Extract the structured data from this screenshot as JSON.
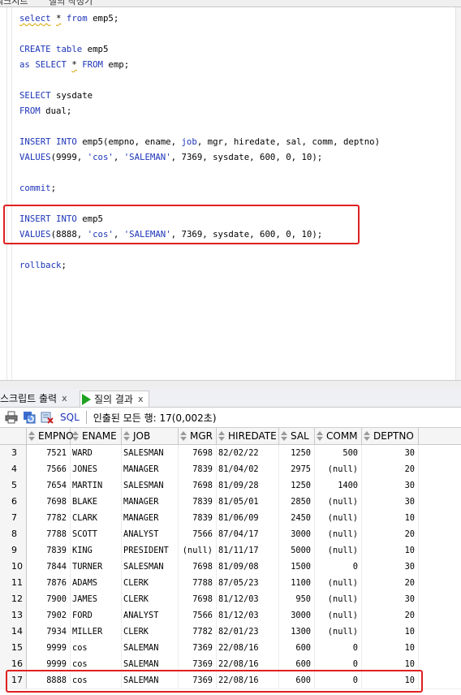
{
  "top_tabs": [
    "워크시트",
    "질의 작성기"
  ],
  "editor": {
    "lines": [
      {
        "parts": [
          {
            "t": "select",
            "c": "kw squig"
          },
          {
            "t": " ",
            "c": ""
          },
          {
            "t": "*",
            "c": "squig"
          },
          {
            "t": " ",
            "c": ""
          },
          {
            "t": "from",
            "c": "kw"
          },
          {
            "t": " emp5;",
            "c": ""
          }
        ]
      },
      {
        "parts": []
      },
      {
        "parts": [
          {
            "t": "CREATE",
            "c": "kw"
          },
          {
            "t": " ",
            "c": ""
          },
          {
            "t": "table",
            "c": "kw"
          },
          {
            "t": " emp5",
            "c": ""
          }
        ]
      },
      {
        "parts": [
          {
            "t": "as",
            "c": "kw"
          },
          {
            "t": " ",
            "c": ""
          },
          {
            "t": "SELECT",
            "c": "kw"
          },
          {
            "t": " ",
            "c": ""
          },
          {
            "t": "*",
            "c": "squig"
          },
          {
            "t": " ",
            "c": ""
          },
          {
            "t": "FROM",
            "c": "kw"
          },
          {
            "t": " emp;",
            "c": ""
          }
        ]
      },
      {
        "parts": []
      },
      {
        "parts": [
          {
            "t": "SELECT",
            "c": "kw"
          },
          {
            "t": " sysdate",
            "c": ""
          }
        ]
      },
      {
        "parts": [
          {
            "t": "FROM",
            "c": "kw"
          },
          {
            "t": " dual;",
            "c": ""
          }
        ]
      },
      {
        "parts": []
      },
      {
        "parts": [
          {
            "t": "INSERT",
            "c": "kw"
          },
          {
            "t": " ",
            "c": ""
          },
          {
            "t": "INTO",
            "c": "kw"
          },
          {
            "t": " emp5(empno, ename, ",
            "c": ""
          },
          {
            "t": "job",
            "c": "kw"
          },
          {
            "t": ", mgr, hiredate, sal, comm, deptno)",
            "c": ""
          }
        ]
      },
      {
        "parts": [
          {
            "t": "VALUES",
            "c": "kw"
          },
          {
            "t": "(9999, ",
            "c": ""
          },
          {
            "t": "'cos'",
            "c": "str"
          },
          {
            "t": ", ",
            "c": ""
          },
          {
            "t": "'SALEMAN'",
            "c": "str"
          },
          {
            "t": ", 7369, sysdate, 600, 0, 10);",
            "c": ""
          }
        ]
      },
      {
        "parts": []
      },
      {
        "parts": [
          {
            "t": "commit",
            "c": "kw"
          },
          {
            "t": ";",
            "c": ""
          }
        ]
      },
      {
        "parts": []
      },
      {
        "parts": [
          {
            "t": "INSERT",
            "c": "kw"
          },
          {
            "t": " ",
            "c": ""
          },
          {
            "t": "INTO",
            "c": "kw"
          },
          {
            "t": " emp5",
            "c": ""
          }
        ]
      },
      {
        "parts": [
          {
            "t": "VALUES",
            "c": "kw"
          },
          {
            "t": "(8888, ",
            "c": ""
          },
          {
            "t": "'cos'",
            "c": "str"
          },
          {
            "t": ", ",
            "c": ""
          },
          {
            "t": "'SALEMAN'",
            "c": "str"
          },
          {
            "t": ", 7369, sysdate, 600, 0, 10);",
            "c": ""
          }
        ]
      },
      {
        "parts": []
      },
      {
        "parts": [
          {
            "t": "rollback",
            "c": "kw"
          },
          {
            "t": ";",
            "c": ""
          }
        ]
      }
    ]
  },
  "bottom_tabs": {
    "script_output": "스크립트 출력",
    "query_result": "질의 결과",
    "close": "x"
  },
  "toolbar": {
    "sql_label": "SQL",
    "status": "인출된 모든 행: 17(0,002초)",
    "icons": [
      "print-icon",
      "refresh-icon",
      "export-icon"
    ]
  },
  "grid": {
    "columns": [
      "EMPNO",
      "ENAME",
      "JOB",
      "MGR",
      "HIREDATE",
      "SAL",
      "COMM",
      "DEPTNO"
    ],
    "rows": [
      {
        "n": "3",
        "empno": "7521",
        "ename": "WARD",
        "job": "SALESMAN",
        "mgr": "7698",
        "hiredate": "82/02/22",
        "sal": "1250",
        "comm": "500",
        "deptno": "30"
      },
      {
        "n": "4",
        "empno": "7566",
        "ename": "JONES",
        "job": "MANAGER",
        "mgr": "7839",
        "hiredate": "81/04/02",
        "sal": "2975",
        "comm": "(null)",
        "deptno": "20"
      },
      {
        "n": "5",
        "empno": "7654",
        "ename": "MARTIN",
        "job": "SALESMAN",
        "mgr": "7698",
        "hiredate": "81/09/28",
        "sal": "1250",
        "comm": "1400",
        "deptno": "30"
      },
      {
        "n": "6",
        "empno": "7698",
        "ename": "BLAKE",
        "job": "MANAGER",
        "mgr": "7839",
        "hiredate": "81/05/01",
        "sal": "2850",
        "comm": "(null)",
        "deptno": "30"
      },
      {
        "n": "7",
        "empno": "7782",
        "ename": "CLARK",
        "job": "MANAGER",
        "mgr": "7839",
        "hiredate": "81/06/09",
        "sal": "2450",
        "comm": "(null)",
        "deptno": "10"
      },
      {
        "n": "8",
        "empno": "7788",
        "ename": "SCOTT",
        "job": "ANALYST",
        "mgr": "7566",
        "hiredate": "87/04/17",
        "sal": "3000",
        "comm": "(null)",
        "deptno": "20"
      },
      {
        "n": "9",
        "empno": "7839",
        "ename": "KING",
        "job": "PRESIDENT",
        "mgr": "(null)",
        "hiredate": "81/11/17",
        "sal": "5000",
        "comm": "(null)",
        "deptno": "10"
      },
      {
        "n": "10",
        "empno": "7844",
        "ename": "TURNER",
        "job": "SALESMAN",
        "mgr": "7698",
        "hiredate": "81/09/08",
        "sal": "1500",
        "comm": "0",
        "deptno": "30"
      },
      {
        "n": "11",
        "empno": "7876",
        "ename": "ADAMS",
        "job": "CLERK",
        "mgr": "7788",
        "hiredate": "87/05/23",
        "sal": "1100",
        "comm": "(null)",
        "deptno": "20"
      },
      {
        "n": "12",
        "empno": "7900",
        "ename": "JAMES",
        "job": "CLERK",
        "mgr": "7698",
        "hiredate": "81/12/03",
        "sal": "950",
        "comm": "(null)",
        "deptno": "30"
      },
      {
        "n": "13",
        "empno": "7902",
        "ename": "FORD",
        "job": "ANALYST",
        "mgr": "7566",
        "hiredate": "81/12/03",
        "sal": "3000",
        "comm": "(null)",
        "deptno": "20"
      },
      {
        "n": "14",
        "empno": "7934",
        "ename": "MILLER",
        "job": "CLERK",
        "mgr": "7782",
        "hiredate": "82/01/23",
        "sal": "1300",
        "comm": "(null)",
        "deptno": "10"
      },
      {
        "n": "15",
        "empno": "9999",
        "ename": "cos",
        "job": "SALEMAN",
        "mgr": "7369",
        "hiredate": "22/08/16",
        "sal": "600",
        "comm": "0",
        "deptno": "10"
      },
      {
        "n": "16",
        "empno": "9999",
        "ename": "cos",
        "job": "SALEMAN",
        "mgr": "7369",
        "hiredate": "22/08/16",
        "sal": "600",
        "comm": "0",
        "deptno": "10"
      },
      {
        "n": "17",
        "empno": "8888",
        "ename": "cos",
        "job": "SALEMAN",
        "mgr": "7369",
        "hiredate": "22/08/16",
        "sal": "600",
        "comm": "0",
        "deptno": "10"
      }
    ]
  },
  "colors": {
    "keyword": "#1c34b8",
    "highlight": "#e02020",
    "run_icon": "#1fa21f"
  }
}
